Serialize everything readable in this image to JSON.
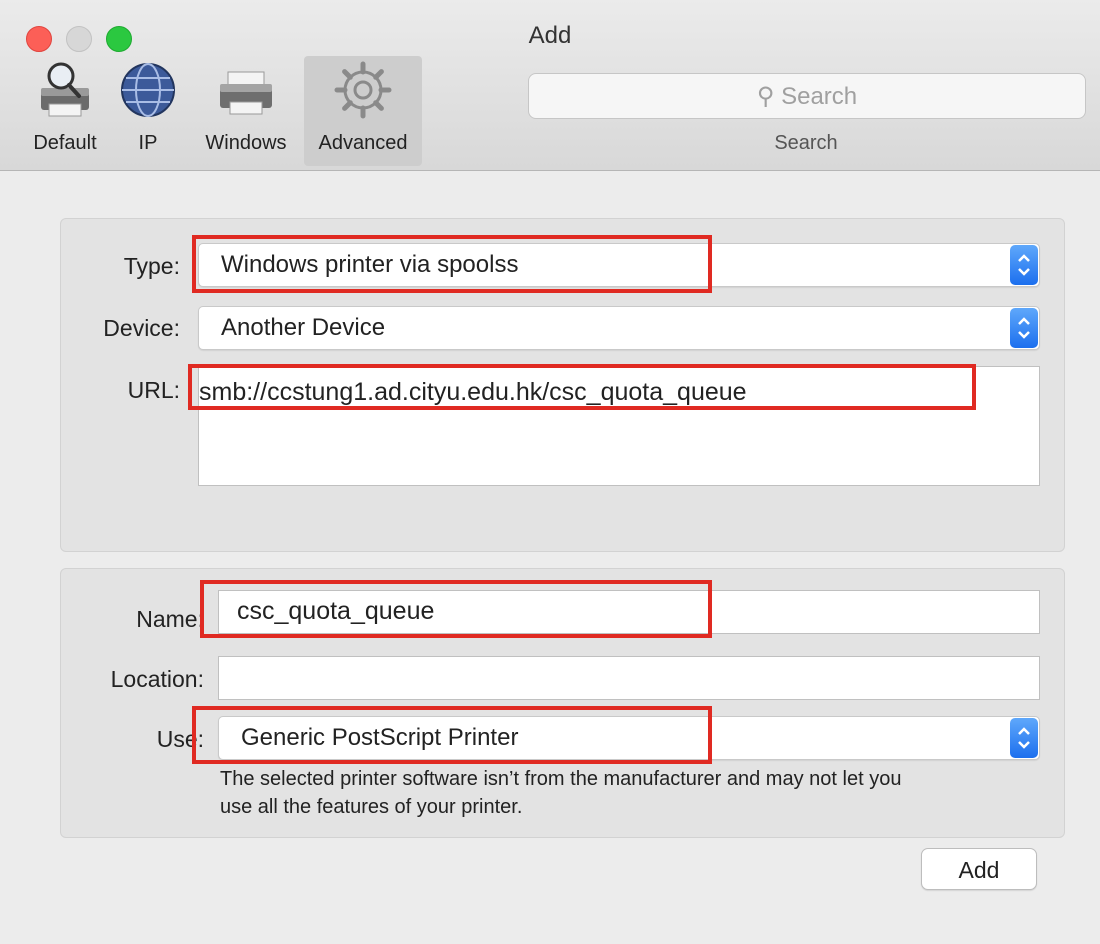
{
  "window": {
    "title": "Add"
  },
  "toolbar": {
    "buttons": [
      {
        "label": "Default",
        "icon": "default-printer-icon"
      },
      {
        "label": "IP",
        "icon": "globe-icon"
      },
      {
        "label": "Windows",
        "icon": "windows-printer-icon"
      },
      {
        "label": "Advanced",
        "icon": "gear-icon",
        "selected": true
      }
    ],
    "search": {
      "placeholder": "Search",
      "caption": "Search"
    }
  },
  "connection": {
    "type_label": "Type:",
    "type_value": "Windows printer via spoolss",
    "device_label": "Device:",
    "device_value": "Another Device",
    "url_label": "URL:",
    "url_value": "smb://ccstung1.ad.cityu.edu.hk/csc_quota_queue"
  },
  "printer": {
    "name_label": "Name:",
    "name_value": "csc_quota_queue",
    "location_label": "Location:",
    "location_value": "",
    "use_label": "Use:",
    "use_value": "Generic PostScript Printer",
    "note_line1": "The selected printer software isn’t from the manufacturer and may not let you",
    "note_line2": "use all the features of your printer."
  },
  "footer": {
    "add_label": "Add"
  },
  "colors": {
    "highlight": "#e02a22",
    "accent": "#1c6fee",
    "close": "#fc5f57",
    "minimize": "#d7d7d7",
    "zoom": "#2bc840"
  }
}
